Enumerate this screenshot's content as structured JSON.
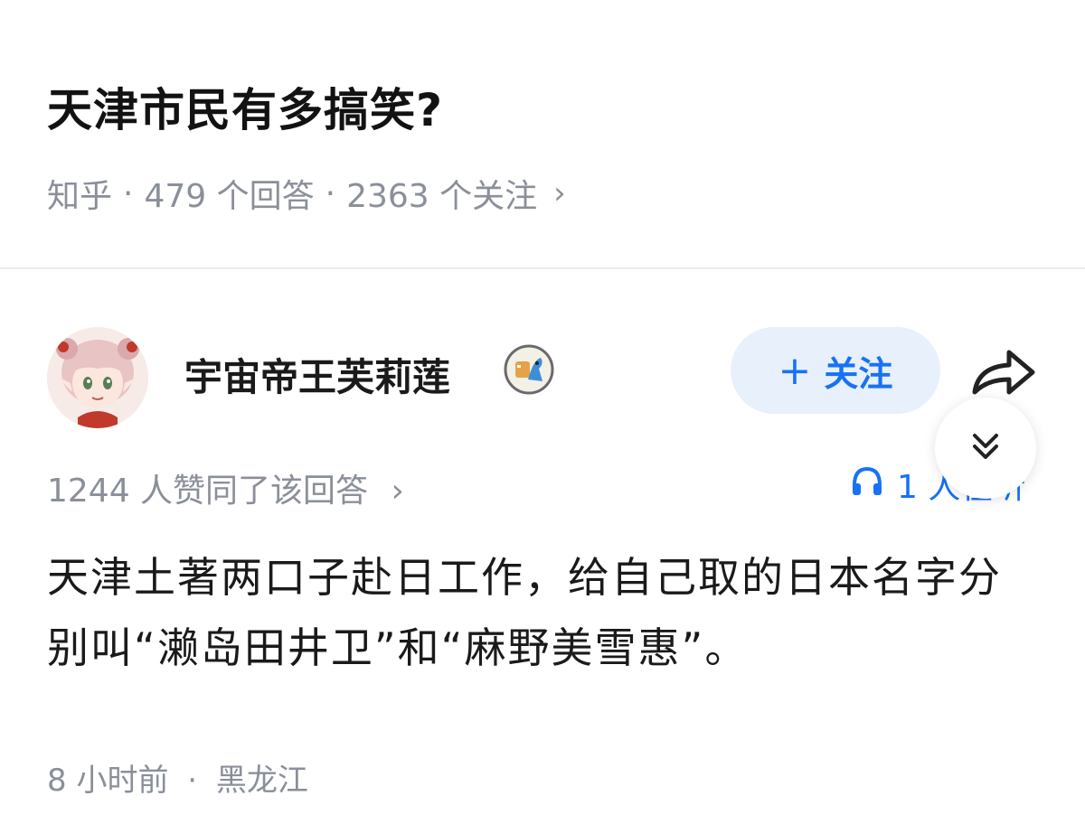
{
  "question": {
    "title": "天津市民有多搞笑?",
    "source": "知乎",
    "separator": "·",
    "answers_count": "479 个回答",
    "followers_count": "2363 个关注",
    "chevron": "›"
  },
  "author": {
    "name": "宇宙帝王芙莉莲",
    "avatar_icon": "anime-avatar-icon",
    "badge_icon": "creature-badge-icon"
  },
  "actions": {
    "follow_plus": "+",
    "follow_label": "关注",
    "share_icon": "share-arrow-icon",
    "collapse_icon": "chevron-double-down-icon"
  },
  "answer": {
    "votes": "1244 人赞同了该回答",
    "chevron": "›",
    "listen_icon": "headphones-icon",
    "listen_text": "1 人在听",
    "body": "天津土著两口子赴日工作，给自己取的日本名字分别叫“濑岛田井卫”和“麻野美雪惠”。",
    "time": "8 小时前",
    "separator": "·",
    "location": "黑龙江"
  },
  "colors": {
    "accent": "#1772f6",
    "follow_bg": "#e8f0fb",
    "meta_text": "#8a8f99",
    "divider": "#ececec"
  }
}
